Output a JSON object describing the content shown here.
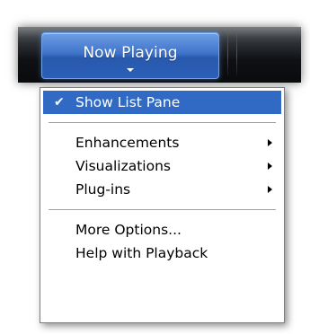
{
  "toolbar": {
    "tab_label": "Now Playing",
    "tab_arrow_icon": "chevron-down-icon"
  },
  "menu": {
    "items": [
      {
        "label": "Show List Pane",
        "checked": true,
        "selected": true,
        "submenu": false
      },
      {
        "label": "Enhancements",
        "checked": false,
        "selected": false,
        "submenu": true
      },
      {
        "label": "Visualizations",
        "checked": false,
        "selected": false,
        "submenu": true
      },
      {
        "label": "Plug-ins",
        "checked": false,
        "selected": false,
        "submenu": true
      },
      {
        "label": "More Options...",
        "checked": false,
        "selected": false,
        "submenu": false
      },
      {
        "label": "Help with Playback",
        "checked": false,
        "selected": false,
        "submenu": false
      }
    ],
    "check_glyph": "✔"
  },
  "colors": {
    "highlight": "#316ac5",
    "tab_blue": "#3f73c9",
    "toolbar_dark": "#0e1013"
  }
}
